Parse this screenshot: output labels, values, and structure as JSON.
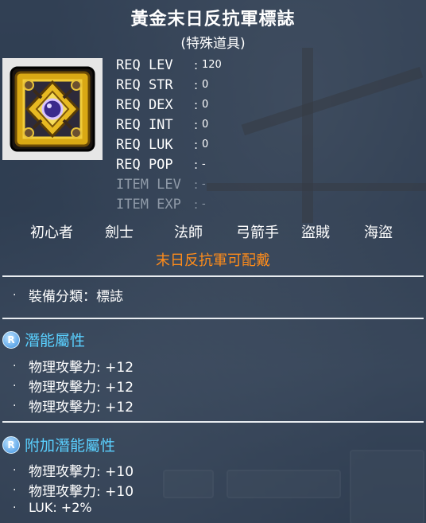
{
  "item": {
    "name": "黃金末日反抗軍標誌",
    "category": "(特殊道具)"
  },
  "requirements": [
    {
      "label": "REQ LEV",
      "value": "120",
      "dim": false
    },
    {
      "label": "REQ STR",
      "value": "0",
      "dim": false
    },
    {
      "label": "REQ DEX",
      "value": "0",
      "dim": false
    },
    {
      "label": "REQ INT",
      "value": "0",
      "dim": false
    },
    {
      "label": "REQ LUK",
      "value": "0",
      "dim": false
    },
    {
      "label": "REQ POP",
      "value": "-",
      "dim": false
    },
    {
      "label": "ITEM LEV",
      "value": "-",
      "dim": true
    },
    {
      "label": "ITEM EXP",
      "value": "-",
      "dim": true
    }
  ],
  "jobs": [
    "初心者",
    "劍士",
    "法師",
    "弓箭手",
    "盜賊",
    "海盜"
  ],
  "restriction": "末日反抗軍可配戴",
  "equip_type": "裝備分類：標誌",
  "potential": {
    "badge": "R",
    "title": "潛能屬性",
    "lines": [
      "物理攻擊力: +12",
      "物理攻擊力: +12",
      "物理攻擊力: +12"
    ]
  },
  "bonus_potential": {
    "badge": "R",
    "title": "附加潛能屬性",
    "lines": [
      "物理攻擊力: +10",
      "物理攻擊力: +10",
      "LUK: +2%"
    ]
  },
  "colors": {
    "restriction": "#ff8c1a",
    "section_title": "#5ad0ff",
    "dim_text": "#8f9aa8"
  },
  "icon": "golden-resistance-emblem-icon"
}
